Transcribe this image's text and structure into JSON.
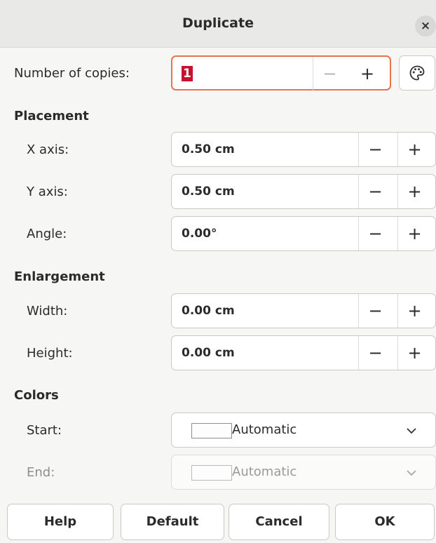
{
  "dialog": {
    "title": "Duplicate",
    "close_label": "×"
  },
  "copies": {
    "label": "Number of copies:",
    "value": "1",
    "minus": "−",
    "plus": "+"
  },
  "placement": {
    "heading": "Placement",
    "x_axis": {
      "label": "X axis:",
      "value": "0.50 cm"
    },
    "y_axis": {
      "label": "Y axis:",
      "value": "0.50 cm"
    },
    "angle": {
      "label": "Angle:",
      "value": "0.00°"
    }
  },
  "enlargement": {
    "heading": "Enlargement",
    "width": {
      "label": "Width:",
      "value": "0.00 cm"
    },
    "height": {
      "label": "Height:",
      "value": "0.00 cm"
    }
  },
  "colors": {
    "heading": "Colors",
    "start": {
      "label": "Start:",
      "value": "Automatic"
    },
    "end": {
      "label": "End:",
      "value": "Automatic",
      "disabled": true
    }
  },
  "stepper": {
    "minus": "−",
    "plus": "+"
  },
  "buttons": {
    "help": "Help",
    "default": "Default",
    "cancel": "Cancel",
    "ok": "OK"
  },
  "icons": {
    "close": "close-icon",
    "values_from_selection": "palette-icon",
    "dropdown": "chevron-down-icon"
  },
  "theme": {
    "focus_border": "#e9734d",
    "selection_bg": "#c8112e"
  }
}
